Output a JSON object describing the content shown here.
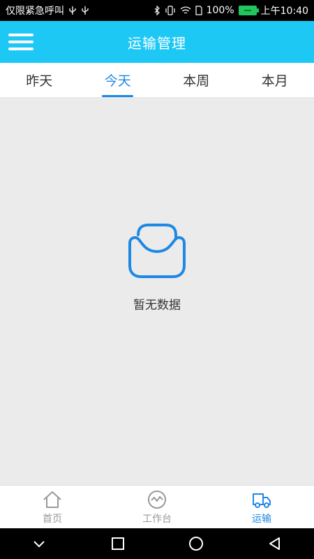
{
  "status_bar": {
    "left_text": "仅限紧急呼叫",
    "left_icons": [
      "usb-icon",
      "usb-icon"
    ],
    "battery": "100%",
    "time": "上午10:40",
    "right_icons": [
      "bluetooth-icon",
      "vibrate-icon",
      "wifi-icon",
      "sim-icon",
      "battery-icon"
    ]
  },
  "header": {
    "title": "运输管理",
    "menu_icon": "hamburger-menu-icon",
    "background": "#1ec8f5"
  },
  "tabs": [
    {
      "label": "昨天"
    },
    {
      "label": "今天",
      "active": true
    },
    {
      "label": "本周"
    },
    {
      "label": "本月"
    }
  ],
  "empty_state": {
    "icon": "empty-box-icon",
    "text": "暂无数据"
  },
  "bottom_nav": [
    {
      "label": "首页",
      "icon": "home-icon"
    },
    {
      "label": "工作台",
      "icon": "pulse-icon"
    },
    {
      "label": "运输",
      "icon": "truck-icon",
      "active": true
    }
  ],
  "colors": {
    "accent": "#1e88e5",
    "header": "#1ec8f5",
    "background": "#ebebeb"
  },
  "system_nav": [
    "chevron-down-icon",
    "square-icon",
    "circle-icon",
    "triangle-back-icon"
  ]
}
